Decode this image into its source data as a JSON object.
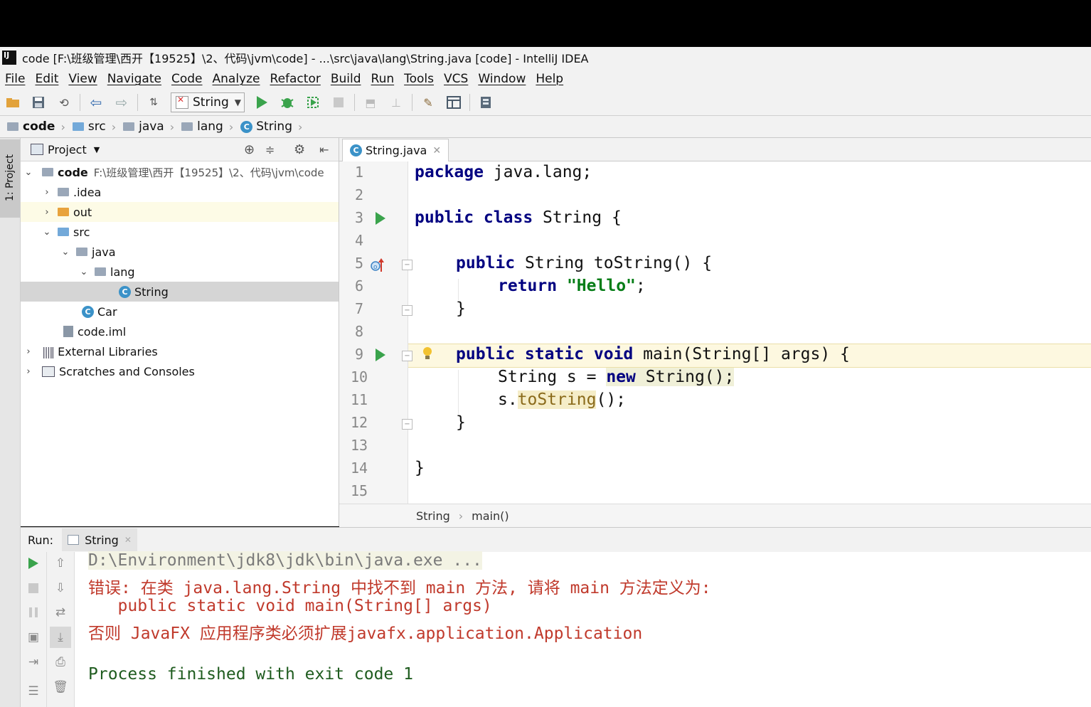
{
  "window": {
    "logo": "IJ",
    "title": "code [F:\\班级管理\\西开【19525】\\2、代码\\jvm\\code] - ...\\src\\java\\lang\\String.java [code] - IntelliJ IDEA"
  },
  "menu": [
    "File",
    "Edit",
    "View",
    "Navigate",
    "Code",
    "Analyze",
    "Refactor",
    "Build",
    "Run",
    "Tools",
    "VCS",
    "Window",
    "Help"
  ],
  "toolbar": {
    "run_config": "String"
  },
  "breadcrumb": [
    "code",
    "src",
    "java",
    "lang",
    "String"
  ],
  "left_stripe": {
    "project_tab": "1: Project"
  },
  "project": {
    "header": "Project",
    "root": {
      "name": "code",
      "path": "F:\\班级管理\\西开【19525】\\2、代码\\jvm\\code"
    },
    "items": [
      {
        "label": ".idea"
      },
      {
        "label": "out"
      },
      {
        "label": "src"
      },
      {
        "label": "java"
      },
      {
        "label": "lang"
      },
      {
        "label": "String"
      },
      {
        "label": "Car"
      },
      {
        "label": "code.iml"
      },
      {
        "label": "External Libraries"
      },
      {
        "label": "Scratches and Consoles"
      }
    ]
  },
  "editor": {
    "tab": "String.java",
    "line_numbers": [
      "1",
      "2",
      "3",
      "4",
      "5",
      "6",
      "7",
      "8",
      "9",
      "10",
      "11",
      "12",
      "13",
      "14",
      "15"
    ],
    "code": {
      "l1_kw": "package",
      "l1_rest": " java.lang;",
      "l3_kw": "public class",
      "l3_rest": " String {",
      "l5_kw": "public",
      "l5_rest": " String toString() {",
      "l6_kw": "return",
      "l6_str": "\"Hello\"",
      "l6_end": ";",
      "l7": "}",
      "l9_kw": "public static void",
      "l9_rest": " main(String[] args) {",
      "l10_a": "String s = ",
      "l10_kw": "new",
      "l10_b": " String();",
      "l11_a": "s.",
      "l11_hl": "toString",
      "l11_b": "();",
      "l12": "}",
      "l14": "}"
    },
    "status": {
      "class": "String",
      "method": "main()"
    }
  },
  "run": {
    "label": "Run:",
    "tab": "String",
    "console": {
      "cmd": "D:\\Environment\\jdk8\\jdk\\bin\\java.exe ...",
      "err1": "错误: 在类 java.lang.String 中找不到 main 方法, 请将 main 方法定义为:",
      "err2": "   public static void main(String[] args)",
      "err3": "否则 JavaFX 应用程序类必须扩展javafx.application.Application",
      "exit": "Process finished with exit code 1"
    }
  },
  "colors": {
    "keyword": "#000080",
    "string": "#067d17",
    "error": "#c0392b",
    "run_green": "#3aa34c",
    "cmd": "#7a7a7a",
    "exit": "#1f5c1f"
  }
}
